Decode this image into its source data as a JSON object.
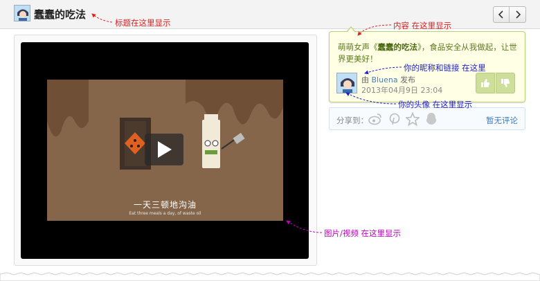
{
  "header": {
    "title": "蠢蠢的吃法"
  },
  "annotations": {
    "title_note": "标题在这里显示",
    "content_note": "内容 在这里显示",
    "nickname_note": "你的昵称和链接 在这里",
    "avatar_note": "你的头像 在这里显示",
    "media_note": "图片/视频 在这里显示"
  },
  "video": {
    "subtitle_zh": "一天三顿地沟油",
    "subtitle_en": "Eat three meals a day, of waste oil"
  },
  "post": {
    "content_prefix": "萌萌女声《",
    "content_link": "蠢蠢的吃法",
    "content_suffix": "》，食品安全从我做起，让世界更美好！",
    "by_prefix": "由",
    "nickname": "Bluena",
    "by_suffix": "发布",
    "timestamp": "2013年04月9日 23:04"
  },
  "share": {
    "label": "分享到：",
    "icons": [
      "weibo-icon",
      "pinterest-icon",
      "star-icon",
      "qq-icon"
    ],
    "no_comment": "暂无评论"
  },
  "colors": {
    "annotation_red": "#e02020",
    "annotation_blue": "#2020d0",
    "annotation_magenta": "#c000c0",
    "bubble_bg": "#ffffe6",
    "vote_green": "#cddf9a"
  }
}
